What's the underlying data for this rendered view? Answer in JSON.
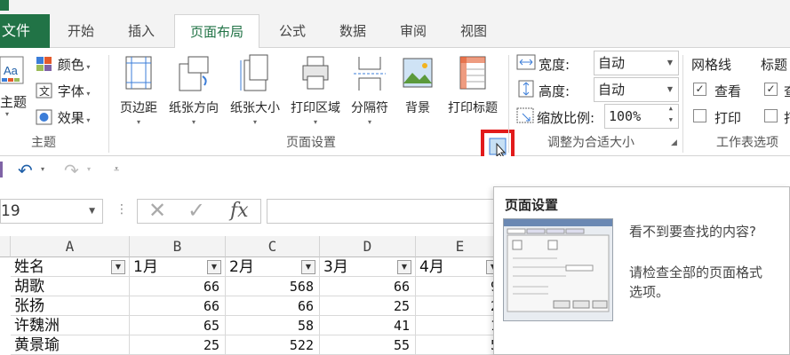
{
  "tabs": {
    "file": "文件",
    "items": [
      "开始",
      "插入",
      "页面布局",
      "公式",
      "数据",
      "审阅",
      "视图"
    ],
    "active": "页面布局"
  },
  "ribbon": {
    "theme_group": {
      "label": "主题",
      "themes_btn": "主题",
      "colors": "颜色",
      "fonts": "字体",
      "effects": "效果"
    },
    "page_setup_group": {
      "label": "页面设置",
      "buttons": [
        "页边距",
        "纸张方向",
        "纸张大小",
        "打印区域",
        "分隔符",
        "背景",
        "打印标题"
      ]
    },
    "scale_group": {
      "label": "调整为合适大小",
      "width_label": "宽度:",
      "width_value": "自动",
      "height_label": "高度:",
      "height_value": "自动",
      "scale_label": "缩放比例:",
      "scale_value": "100%"
    },
    "sheet_options_group": {
      "label": "工作表选项",
      "gridlines_title": "网格线",
      "headings_title": "标题",
      "view_label": "查看",
      "print_label": "打印",
      "view_label_cut": "查",
      "print_label_cut": "打"
    }
  },
  "namebox": {
    "value": "19"
  },
  "grid": {
    "columns": [
      "A",
      "B",
      "C",
      "D",
      "E"
    ],
    "headers": [
      "姓名",
      "1月",
      "2月",
      "3月",
      "4月"
    ],
    "rows": [
      [
        "胡歌",
        "66",
        "568",
        "66",
        "9"
      ],
      [
        "张扬",
        "66",
        "66",
        "25",
        "2"
      ],
      [
        "许魏洲",
        "65",
        "58",
        "41",
        "1"
      ],
      [
        "黄景瑜",
        "25",
        "522",
        "55",
        "5"
      ]
    ]
  },
  "tooltip": {
    "title": "页面设置",
    "line1": "看不到要查找的内容?",
    "line2": "请检查全部的页面格式",
    "line3": "选项。"
  },
  "colors": {
    "accent": "#217346",
    "highlight": "#e21b1b"
  }
}
